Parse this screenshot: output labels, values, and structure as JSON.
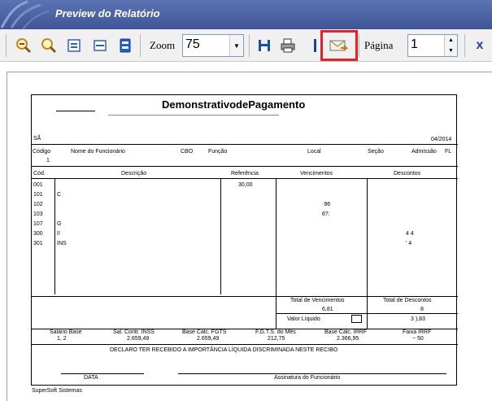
{
  "window": {
    "title": "Preview do Relatório"
  },
  "toolbar": {
    "zoom_label": "Zoom",
    "zoom_value": "75",
    "page_label": "Página",
    "page_value": "1"
  },
  "report": {
    "title": "DemonstrativodePagamento",
    "company_prefix": "SÃ",
    "period": "04/2014",
    "headers": {
      "codigo": "Código",
      "nome": "Nome  do  Funcionário",
      "cbo": "CBO",
      "funcao": "Função",
      "local": "Local",
      "secao": "Seção",
      "admissao": "Admissão",
      "fl": "FL"
    },
    "employee_code": "1",
    "columns": {
      "cod": "Cód.",
      "descricao": "Descrição",
      "referencia": "Referência",
      "vencimentos": "Vencimentos",
      "descontos": "Descontos"
    },
    "rows": [
      {
        "cod": "001",
        "desc": "",
        "ref": "30,00",
        "venc": "",
        "desc_val": ""
      },
      {
        "cod": "101",
        "desc": "C",
        "ref": "",
        "venc": "",
        "desc_val": ""
      },
      {
        "cod": "102",
        "desc": "",
        "ref": "",
        "venc": "·96",
        "desc_val": ""
      },
      {
        "cod": "103",
        "desc": "",
        "ref": "",
        "venc": "6?.",
        "desc_val": ""
      },
      {
        "cod": "107",
        "desc": "G",
        "ref": "",
        "venc": "",
        "desc_val": ""
      },
      {
        "cod": "300",
        "desc": "I!",
        "ref": "",
        "venc": "",
        "desc_val": "4    4"
      },
      {
        "cod": "301",
        "desc": "INS",
        "ref": "",
        "venc": "",
        "desc_val": "' 4"
      }
    ],
    "totals": {
      "total_venc_label": "Total  de  Vencimentos",
      "total_venc_value": "6,81",
      "total_desc_label": "Total  de  Descontos",
      "total_desc_value": "8",
      "liquido_label": "Valor  Líquido",
      "liquido_value": "3   ),83"
    },
    "bases": {
      "salario_label": "Salário  Base",
      "salario_value": "1,    2",
      "inss_label": "Sal.  Contr.  INSS",
      "inss_value": "2.659,49",
      "fgts_label": "Base  Cálc.  FGTS",
      "fgts_value": "2.659,49",
      "fgts_mes_label": "F.G.T.S.  do  Mês",
      "fgts_mes_value": "212,75",
      "irrf_label": "Base  Cálc.  IRRF",
      "irrf_value": "2.366,95",
      "faixa_label": "Faixa  IRRF",
      "faixa_value": "~  50"
    },
    "declaration": "DECLARO  TER  RECEBIDO  A  IMPORTÂNCIA  LÍQUIDA  DISCRIMINADA  NESTE  RECIBO",
    "date_line": "____/____/______",
    "date_label": "DATA",
    "signature_label": "Assinatura  do  Funcionário"
  },
  "footer": "SuperSoft   Sistemas"
}
